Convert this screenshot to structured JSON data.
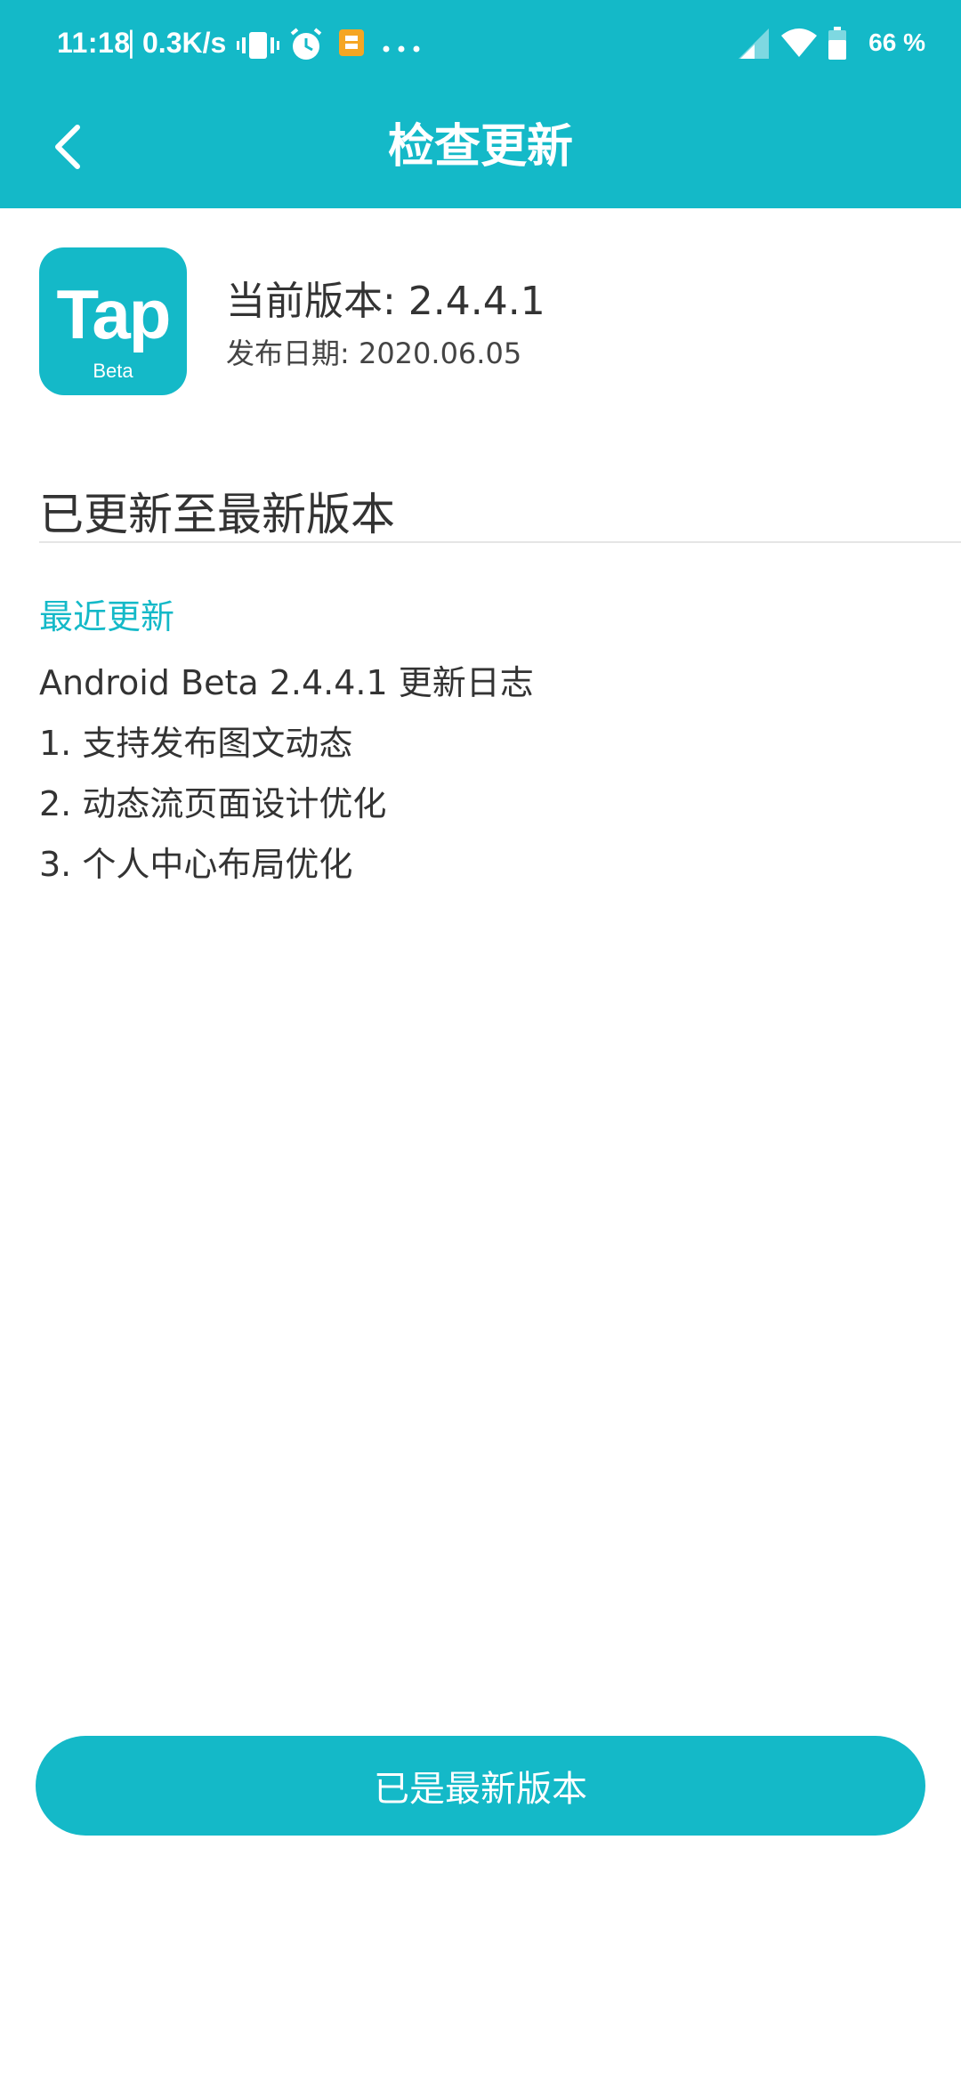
{
  "status_bar": {
    "time": "11:18",
    "separator": "|",
    "net_speed": "0.3K/s",
    "battery_text": "66 %",
    "icons": [
      "vibrate-icon",
      "alarm-icon",
      "notification-app-icon",
      "more-dots-icon",
      "signal-icon",
      "wifi-icon",
      "battery-icon"
    ]
  },
  "navbar": {
    "title": "检查更新",
    "back_icon": "chevron-left-icon"
  },
  "app": {
    "logo_text": "Tap",
    "logo_sub": "Beta",
    "current_version": "当前版本: 2.4.4.1",
    "release_date": "发布日期: 2020.06.05"
  },
  "update_status": "已更新至最新版本",
  "changelog": {
    "label": "最近更新",
    "lines": [
      "Android Beta 2.4.4.1 更新日志",
      "1. 支持发布图文动态",
      "2. 动态流页面设计优化",
      "3. 个人中心布局优化"
    ]
  },
  "action_button": "已是最新版本",
  "colors": {
    "accent": "#14B9C8",
    "text": "#333333",
    "background": "#FFFFFF"
  }
}
